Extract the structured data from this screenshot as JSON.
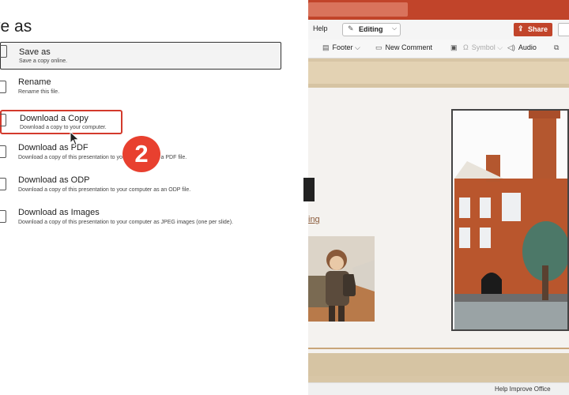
{
  "panel": {
    "title": "ve as",
    "options": [
      {
        "title": "Save as",
        "description": "Save a copy online."
      },
      {
        "title": "Rename",
        "description": "Rename this file."
      },
      {
        "title": "Download a Copy",
        "description": "Download a copy to your computer."
      },
      {
        "title": "Download as PDF",
        "description": "Download a copy of this presentation to your computer as a PDF file."
      },
      {
        "title": "Download as ODP",
        "description": "Download a copy of this presentation to your computer as an ODP file."
      },
      {
        "title": "Download as Images",
        "description": "Download a copy of this presentation to your computer as JPEG images (one per slide)."
      }
    ],
    "step_badge": "2"
  },
  "app": {
    "ribbon": {
      "help_tab": "Help",
      "editing_label": "Editing",
      "share_label": "Share",
      "tools": {
        "footer": "Footer",
        "new_comment": "New Comment",
        "symbol": "Symbol",
        "audio": "Audio"
      }
    },
    "slide": {
      "link_fragment": "ing"
    },
    "status": {
      "help_improve": "Help Improve Office"
    }
  },
  "colors": {
    "accent_red": "#c1442a",
    "highlight_red": "#d33a2c",
    "badge_red": "#e8402f"
  }
}
